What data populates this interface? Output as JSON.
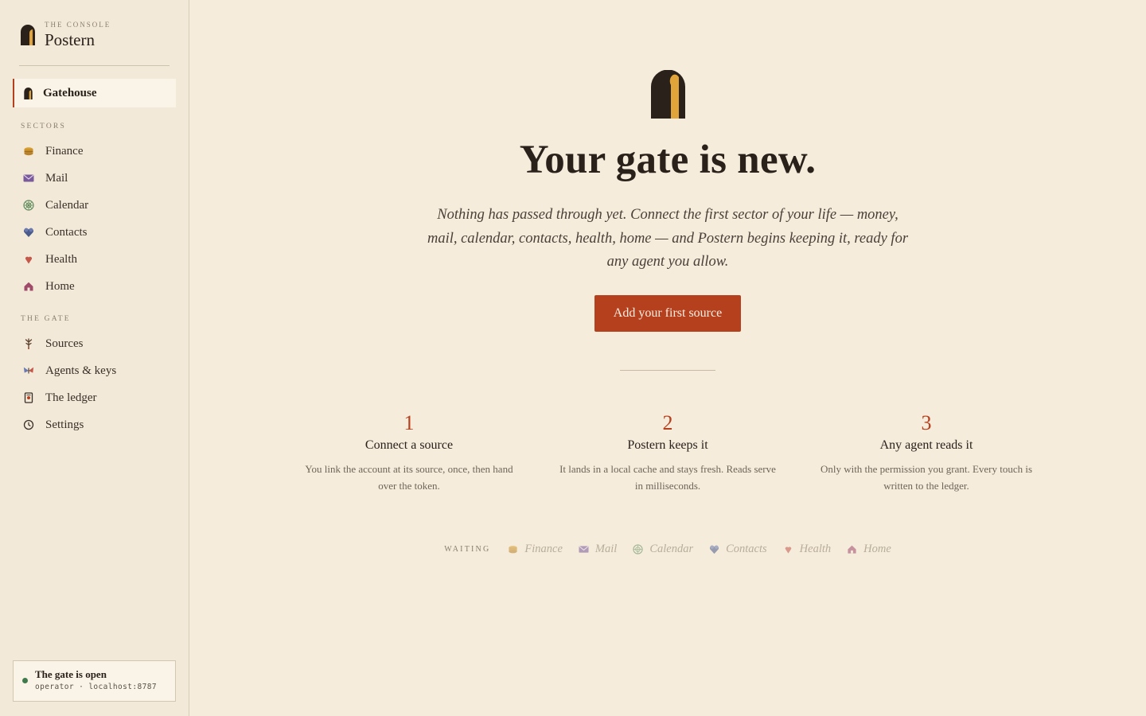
{
  "brand": {
    "sub": "THE CONSOLE",
    "name": "Postern"
  },
  "nav": {
    "active": "Gatehouse",
    "sectors_label": "SECTORS",
    "sectors": [
      "Finance",
      "Mail",
      "Calendar",
      "Contacts",
      "Health",
      "Home"
    ],
    "gate_label": "THE GATE",
    "gate": [
      "Sources",
      "Agents & keys",
      "The ledger",
      "Settings"
    ]
  },
  "status": {
    "title": "The gate is open",
    "sub": "operator · localhost:8787"
  },
  "hero": {
    "title": "Your gate is new.",
    "body": "Nothing has passed through yet. Connect the first sector of your life — money, mail, calendar, contacts, health, home — and Postern begins keeping it, ready for any agent you allow.",
    "cta": "Add your first source"
  },
  "steps": [
    {
      "num": "1",
      "title": "Connect a source",
      "body": "You link the account at its source, once, then hand over the token."
    },
    {
      "num": "2",
      "title": "Postern keeps it",
      "body": "It lands in a local cache and stays fresh. Reads serve in milliseconds."
    },
    {
      "num": "3",
      "title": "Any agent reads it",
      "body": "Only with the permission you grant. Every touch is written to the ledger."
    }
  ],
  "waiting": {
    "label": "WAITING",
    "items": [
      "Finance",
      "Mail",
      "Calendar",
      "Contacts",
      "Health",
      "Home"
    ]
  },
  "icons": {
    "gatehouse": "gate-arch-icon",
    "finance": "coin-stack-icon",
    "mail": "envelope-icon",
    "calendar": "wheel-icon",
    "contacts": "heart-cluster-icon",
    "health": "heart-icon",
    "home": "house-icon",
    "sources": "root-icon",
    "agents": "butterfly-icon",
    "ledger": "ledger-icon",
    "settings": "clock-icon"
  },
  "colors": {
    "accent": "#b5401e",
    "gold": "#e0a43a",
    "dark": "#2a211b",
    "background": "#f5ecdc",
    "status": "#3f7a4c"
  }
}
